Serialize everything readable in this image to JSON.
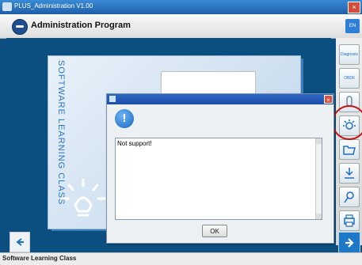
{
  "window": {
    "title": "PLUS_Administration V1.00",
    "close_glyph": "×"
  },
  "header": {
    "title": "Administration Program",
    "lang": "EN"
  },
  "card": {
    "vertical_title": "SOFTWARE LEARNING CLASS"
  },
  "toolbar": [
    {
      "name": "diagnosis",
      "label": "Diagnosis"
    },
    {
      "name": "obd",
      "label": "OBDII"
    },
    {
      "name": "key",
      "label": ""
    },
    {
      "name": "learning",
      "label": ""
    },
    {
      "name": "folder",
      "label": ""
    },
    {
      "name": "download",
      "label": ""
    },
    {
      "name": "search",
      "label": ""
    },
    {
      "name": "printer",
      "label": ""
    }
  ],
  "dialog": {
    "message": "Not support!",
    "ok_label": "OK",
    "close_glyph": "×",
    "info_glyph": "!"
  },
  "status": {
    "text": "Software Learning Class"
  },
  "colors": {
    "accent": "#1e78c8",
    "highlight_circle": "#c41212"
  }
}
